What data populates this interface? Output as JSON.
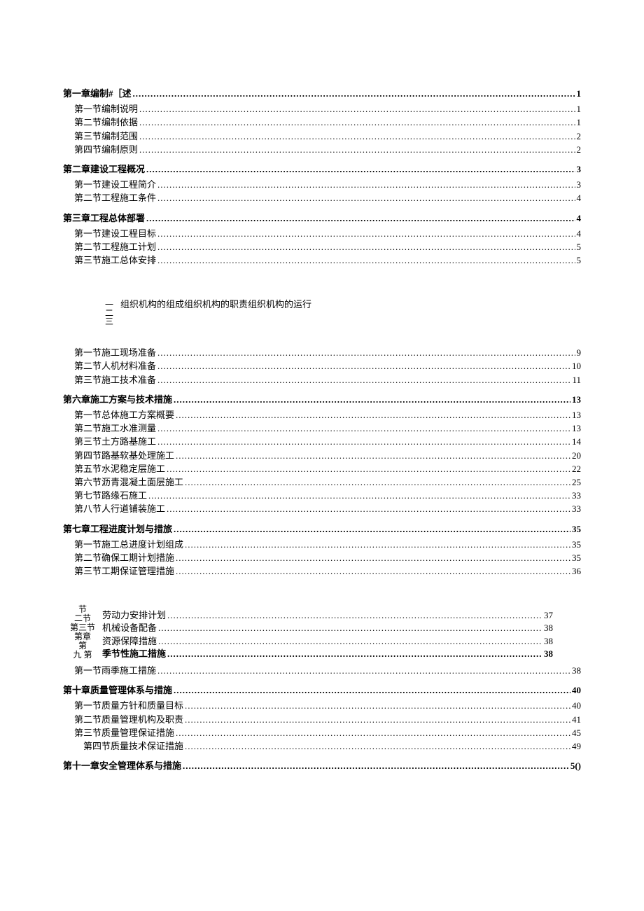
{
  "toc": [
    {
      "type": "heading",
      "label": "第一章编制#［述",
      "page": "1"
    },
    {
      "type": "sub",
      "label": "第一节编制说明",
      "page": "1"
    },
    {
      "type": "sub",
      "label": "第二节编制依据",
      "page": "1"
    },
    {
      "type": "sub",
      "label": "第三节编制范围",
      "page": "2"
    },
    {
      "type": "sub",
      "label": "第四节编制原则",
      "page": "2"
    },
    {
      "type": "heading",
      "label": "第二章建设工程概况",
      "page": "3"
    },
    {
      "type": "sub",
      "label": "第一节建设工程简介",
      "page": "3"
    },
    {
      "type": "sub",
      "label": "第二节工程施工条件",
      "page": "4"
    },
    {
      "type": "heading",
      "label": "第三章工程总体部署",
      "page": "4"
    },
    {
      "type": "sub",
      "label": "第一节建设工程目标",
      "page": "4"
    },
    {
      "type": "sub",
      "label": "第二节工程施工计划",
      "page": "5"
    },
    {
      "type": "sub",
      "label": "第三节施工总体安排",
      "page": "5"
    },
    {
      "type": "fragment",
      "marks": [
        "一",
        "二",
        "三"
      ],
      "text": "组织机构的组成组织机构的职责组织机构的运行"
    },
    {
      "type": "sub",
      "label": "第一节施工现场准备",
      "page": "9"
    },
    {
      "type": "sub",
      "label": "第二节人机材料准备",
      "page": "10"
    },
    {
      "type": "sub",
      "label": "第三节施工技术准备",
      "page": "11"
    },
    {
      "type": "heading",
      "label": "第六章施工方案与技术措施",
      "page": "13"
    },
    {
      "type": "sub",
      "label": "第一节总体施工方案概要",
      "page": "13"
    },
    {
      "type": "sub",
      "label": "第二节施工水准测量",
      "page": "13"
    },
    {
      "type": "sub",
      "label": "第三节土方路基施工",
      "page": "14"
    },
    {
      "type": "sub",
      "label": "第四节路基软基处理施工",
      "page": "20"
    },
    {
      "type": "sub",
      "label": "第五节水泥稳定层施工",
      "page": "22"
    },
    {
      "type": "sub",
      "label": "第六节沥青混凝土面层施工",
      "page": "25"
    },
    {
      "type": "sub",
      "label": "第七节路缘石施工",
      "page": "33"
    },
    {
      "type": "sub",
      "label": "第八节人行道铺装施工",
      "page": "33"
    },
    {
      "type": "heading",
      "label": "第七章工程进度计划与措旅",
      "page": "35"
    },
    {
      "type": "sub",
      "label": "第一节施工总进度计划组成",
      "page": "35"
    },
    {
      "type": "sub",
      "label": "第二节确保工期计划措施",
      "page": "35"
    },
    {
      "type": "sub",
      "label": "第三节工期保证管理措施",
      "page": "36"
    },
    {
      "type": "cluster",
      "stack": [
        "节",
        "二节",
        "第三节",
        "第章",
        "第",
        "九 第"
      ],
      "lines": [
        {
          "label": "劳动力安排计划",
          "page": "37",
          "bold": false
        },
        {
          "label": "机械设备配备",
          "page": "38",
          "bold": false
        },
        {
          "label": "资源保障措施",
          "page": "38",
          "bold": false
        },
        {
          "label": "季节性施工措施",
          "page": "38",
          "bold": true
        }
      ]
    },
    {
      "type": "sub",
      "label": "第一节雨季施工措施",
      "page": "38"
    },
    {
      "type": "heading",
      "label": "第十章质量管理体系与措施",
      "page": "40"
    },
    {
      "type": "sub",
      "label": "第一节质量方针和质量目标",
      "page": "40"
    },
    {
      "type": "sub",
      "label": "第二节质量管理机构及职责",
      "page": "41"
    },
    {
      "type": "sub",
      "label": "第三节质量管理保证措施",
      "page": "45"
    },
    {
      "type": "sub",
      "label": "　第四节质量技术保证措施",
      "page": "49"
    },
    {
      "type": "heading",
      "label": "第十一章安全管理体系与措施",
      "page": "5()"
    }
  ]
}
